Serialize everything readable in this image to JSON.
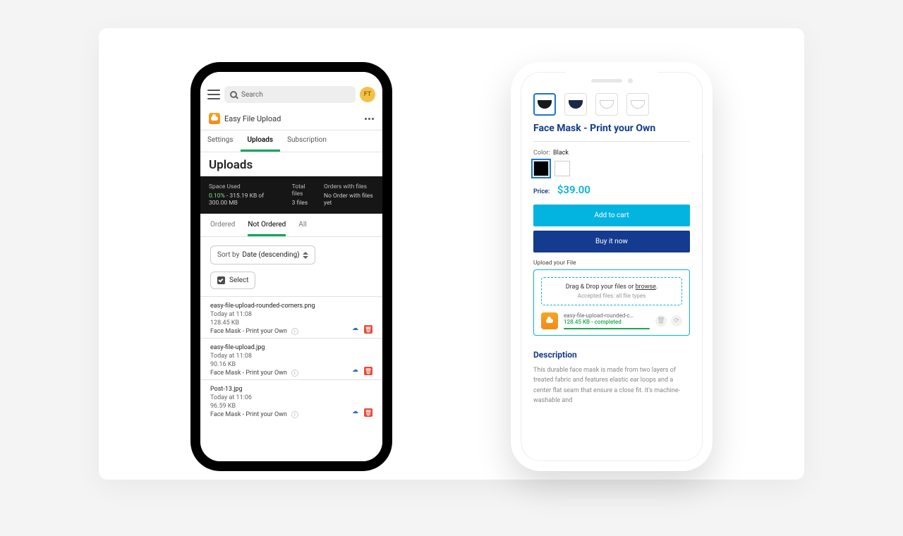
{
  "phoneA": {
    "search_placeholder": "Search",
    "avatar_initials": "FT",
    "app_title": "Easy File Upload",
    "tabs": {
      "settings": "Settings",
      "uploads": "Uploads",
      "subscription": "Subscription"
    },
    "heading": "Uploads",
    "usage": {
      "space_label": "Space Used",
      "space_pct": "0.10%",
      "space_detail": " - 315.19 KB of 300.00 MB",
      "total_label": "Total files",
      "total_value": "3 files",
      "orders_label": "Orders with files",
      "orders_value": "No Order with files yet"
    },
    "subtabs": {
      "ordered": "Ordered",
      "not_ordered": "Not Ordered",
      "all": "All"
    },
    "sort_prefix": "Sort by ",
    "sort_value": "Date (descending)",
    "select_label": "Select",
    "files": [
      {
        "name": "easy-file-upload-rounded-corners.png",
        "when": "Today at 11:08",
        "size": "128.45 KB",
        "product": "Face Mask - Print your Own"
      },
      {
        "name": "easy-file-upload.jpg",
        "when": "Today at 11:08",
        "size": "90.16 KB",
        "product": "Face Mask - Print your Own"
      },
      {
        "name": "Post-13.jpg",
        "when": "Today at 11:06",
        "size": "96.59 KB",
        "product": "Face Mask - Print your Own"
      }
    ]
  },
  "phoneB": {
    "title": "Face Mask - Print your Own",
    "color_label": "Color:",
    "color_value": "Black",
    "price_label": "Price:",
    "price": "$39.00",
    "btn_cart": "Add to cart",
    "btn_buy": "Buy it now",
    "upload_label": "Upload your File",
    "dz_main_pre": "Drag & Drop your files or ",
    "dz_main_link": "browse",
    "dz_main_post": ".",
    "dz_sub": "Accepted files: all file types",
    "uploaded_name": "easy-file-upload-rounded-cor…",
    "uploaded_status": "128.45 KB - completed",
    "desc_heading": "Description",
    "desc_text": "This durable face mask is made from two layers of treated fabric and features elastic ear loops and a center flat seam that ensure a close fit. It's machine-washable and"
  }
}
